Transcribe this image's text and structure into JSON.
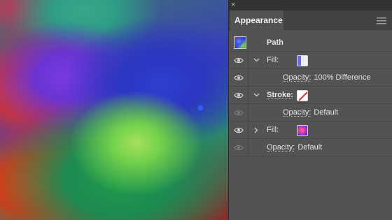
{
  "canvas": {
    "description_colors": {
      "dot": "#2f5bff"
    }
  },
  "panel": {
    "close_glyph": "×",
    "tab_label": "Appearance",
    "path_label": "Path",
    "rows": [
      {
        "key": "Fill:",
        "value": ""
      },
      {
        "key": "Opacity:",
        "value": "100% Difference"
      },
      {
        "key": "Stroke:",
        "value": ""
      },
      {
        "key": "Opacity:",
        "value": "Default"
      },
      {
        "key": "Fill:",
        "value": ""
      },
      {
        "key": "Opacity:",
        "value": "Default"
      }
    ]
  },
  "colors": {
    "panel_bg": "#535353",
    "tab_bar": "#424242",
    "title_bar": "#323232",
    "text": "#e6e6e6",
    "stroke_swatch_slash": "#e0303a"
  }
}
